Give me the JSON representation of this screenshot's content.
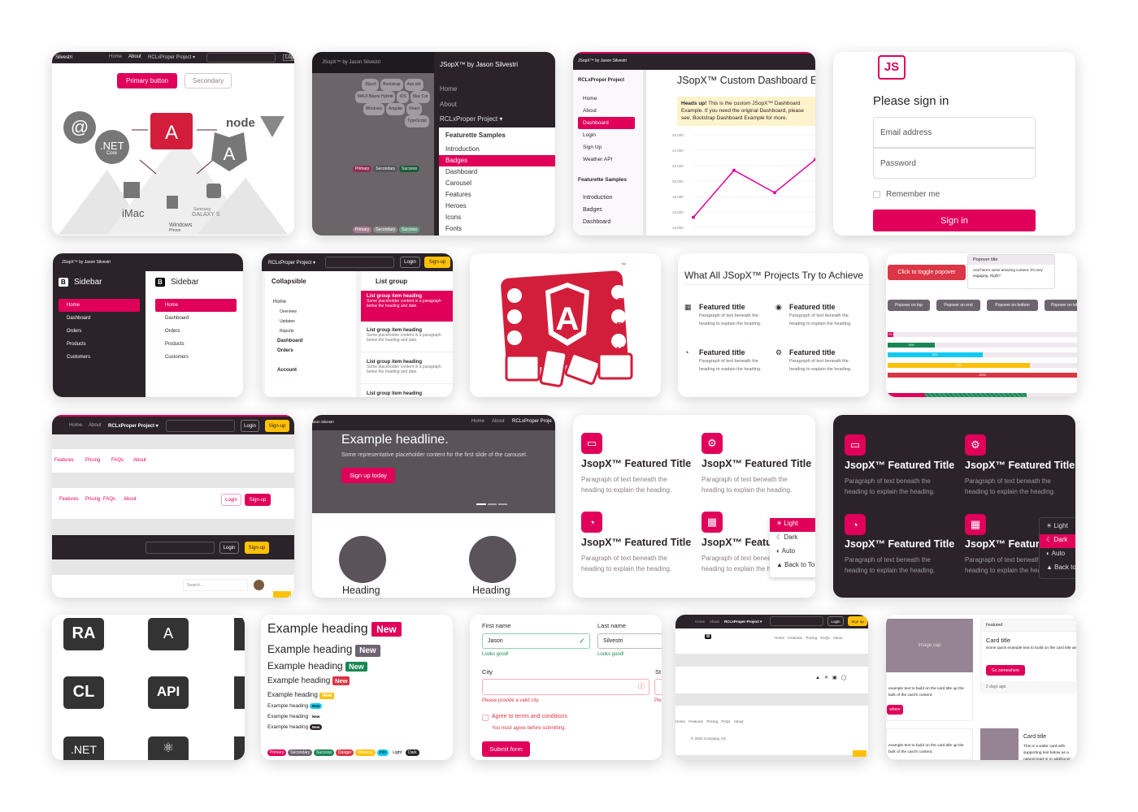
{
  "accent": "#e0005a",
  "dark": "#2b2329",
  "t1": {
    "brand": "Silvestri",
    "nav": [
      "Home",
      "About",
      "RCLxProper Project ▾"
    ],
    "login": "Log",
    "primary": "Primary button",
    "secondary": "Secondary",
    "logos": [
      ".NET",
      "Core",
      "node",
      "iMac",
      "Samsung",
      "GALAXY S",
      "Windows",
      "Phone"
    ]
  },
  "t2": {
    "brand": "JSopX™ by Jason Silvestri",
    "tags": [
      "JSpoX",
      "Bootstrap",
      "Asp.net",
      "MAUI Blazor Hybrid",
      "iOS",
      "Mac Cat",
      "Windows",
      "Angular",
      "React",
      "TypeScript"
    ],
    "badges": [
      "Primary",
      "Secondary",
      "Success"
    ],
    "menu_brand": "JSopX™ by Jason Silvestri",
    "menu": [
      "Home",
      "About",
      "RCLxProper Project ▾"
    ],
    "dropdown_header": "Featurette Samples",
    "dropdown": [
      "Introduction",
      "Badges",
      "Dashboard",
      "Carousel",
      "Features",
      "Heroes",
      "Icons",
      "Fonts"
    ]
  },
  "t3": {
    "brand": "JSopX™ by Jason Silvestri",
    "project": "RCLxProper Project",
    "nav": [
      "Home",
      "About",
      "Dashboard",
      "Login",
      "Sign Up",
      "Weather API"
    ],
    "section": "Featurette Samples",
    "samples": [
      "Introduction",
      "Badges",
      "Dashboard"
    ],
    "title": "JSopX™ Custom Dashboard Example",
    "alert_bold": "Heads up!",
    "alert": " This is the custom JSopX™ Dashboard Example. If you need the original Dashboard, please see, Bootstrap Dashboard Example for more."
  },
  "chart_data": {
    "type": "line",
    "title": "",
    "xlabel": "",
    "ylabel": "",
    "ylim": [
      14000,
      26000
    ],
    "yticks": [
      "14,000",
      "16,000",
      "18,000",
      "20,000",
      "22,000",
      "24,000",
      "26,000"
    ],
    "x": [
      0,
      1,
      2,
      3
    ],
    "values": [
      15300,
      21400,
      18500,
      22800
    ],
    "color": "#e0009a"
  },
  "t4": {
    "logo": "JS",
    "title": "Please sign in",
    "email": "Email address",
    "password": "Password",
    "remember": "Remember me",
    "signin": "Sign in"
  },
  "t5": {
    "brand": "JSopX™ by Jason Silvestri",
    "title": "Sidebar",
    "items": [
      "Home",
      "Dashboard",
      "Orders",
      "Products",
      "Customers"
    ]
  },
  "t6": {
    "project": "RCLxProper Project ▾",
    "login": "Login",
    "signup": "Sign-up",
    "collapsible": "Collapsible",
    "tree": [
      "Home",
      "Overview",
      "Updates",
      "Reports",
      "Dashboard",
      "Orders",
      "Account"
    ],
    "listgroup": "List group",
    "item_heading": "List group item heading",
    "item_text": "Some placeholder content in a paragraph below the heading and date."
  },
  "t7": {
    "letters": [
      "O",
      "P",
      "X"
    ],
    "tm": "™"
  },
  "t8": {
    "title": "What All JSopX™ Projects Try to Achieve",
    "feature_title": "Featured title",
    "feature_text": "Paragraph of text beneath the heading to explain the heading."
  },
  "t9": {
    "toggle": "Click to toggle popover",
    "pop_title": "Popover title",
    "pop_body": "And here's some amazing content. It's very engaging. Right?",
    "buttons": [
      "Popover on top",
      "Popover on end",
      "Popover on bottom",
      "Popover on left"
    ],
    "progress": [
      {
        "label": "0%",
        "value": 3,
        "color": "#e0005a"
      },
      {
        "label": "25%",
        "value": 25,
        "color": "#198754"
      },
      {
        "label": "50%",
        "value": 50,
        "color": "#0dcaf0"
      },
      {
        "label": "75%",
        "value": 75,
        "color": "#ffc107"
      },
      {
        "label": "100%",
        "value": 100,
        "color": "#dc3545"
      }
    ]
  },
  "t10": {
    "nav": [
      "Home",
      "About",
      "RCLxProper Project ▾"
    ],
    "login": "Login",
    "signup": "Sign-up",
    "links": [
      "Features",
      "Pricing",
      "FAQs",
      "About"
    ],
    "search": "Search..."
  },
  "t11": {
    "brand": "ason Silvestri",
    "nav": [
      "Home",
      "About",
      "RCLxProper Proje"
    ],
    "headline": "Example headline.",
    "sub": "Some representative placeholder content for the first slide of the carousel.",
    "cta": "Sign up today",
    "heading": "Heading"
  },
  "t12": {
    "title": "JsopX™ Featured Title",
    "text": "Paragraph of text beneath the heading to explain the heading.",
    "modes": [
      "Light",
      "Dark",
      "Auto",
      "Back to Top"
    ]
  },
  "t14": {
    "labels": [
      "RA",
      "A",
      "CL",
      "API",
      ".NET"
    ]
  },
  "t15": {
    "heading": "Example heading",
    "new": "New",
    "badges": [
      "Primary",
      "Secondary",
      "Success",
      "Danger",
      "Warning",
      "Info",
      "Light",
      "Dark"
    ]
  },
  "t16": {
    "first_label": "First name",
    "first": "Jason",
    "last_label": "Last name",
    "last": "Silvestri",
    "good": "Looks good!",
    "city": "City",
    "state": "St",
    "city_err": "Please provide a valid city.",
    "state_err": "Ple",
    "agree": "Agree to terms and conditions",
    "agree_err": "You must agree before submitting.",
    "submit": "Submit form"
  },
  "t17": {
    "nav": [
      "Home",
      "About",
      "RCLxProper Project ▾"
    ],
    "login": "Login",
    "signup": "Sign-up",
    "links": [
      "Home",
      "Features",
      "Pricing",
      "FAQs",
      "About"
    ],
    "copyright": "© 2024 Company, Inc"
  },
  "t18": {
    "image_cap": "Image cap",
    "featured": "Featured",
    "card_title": "Card title",
    "card_text": "Some quick example text to build on the card title and make up the bulk of the card's content.",
    "go": "Go somewhere",
    "ago": "2 days ago",
    "partial_text": "example text to build on the card title up the bulk of the card's content.",
    "partial_btn": "where",
    "wide_text": "This is a wider card with supporting text below as a natural lead-in to additional content."
  }
}
